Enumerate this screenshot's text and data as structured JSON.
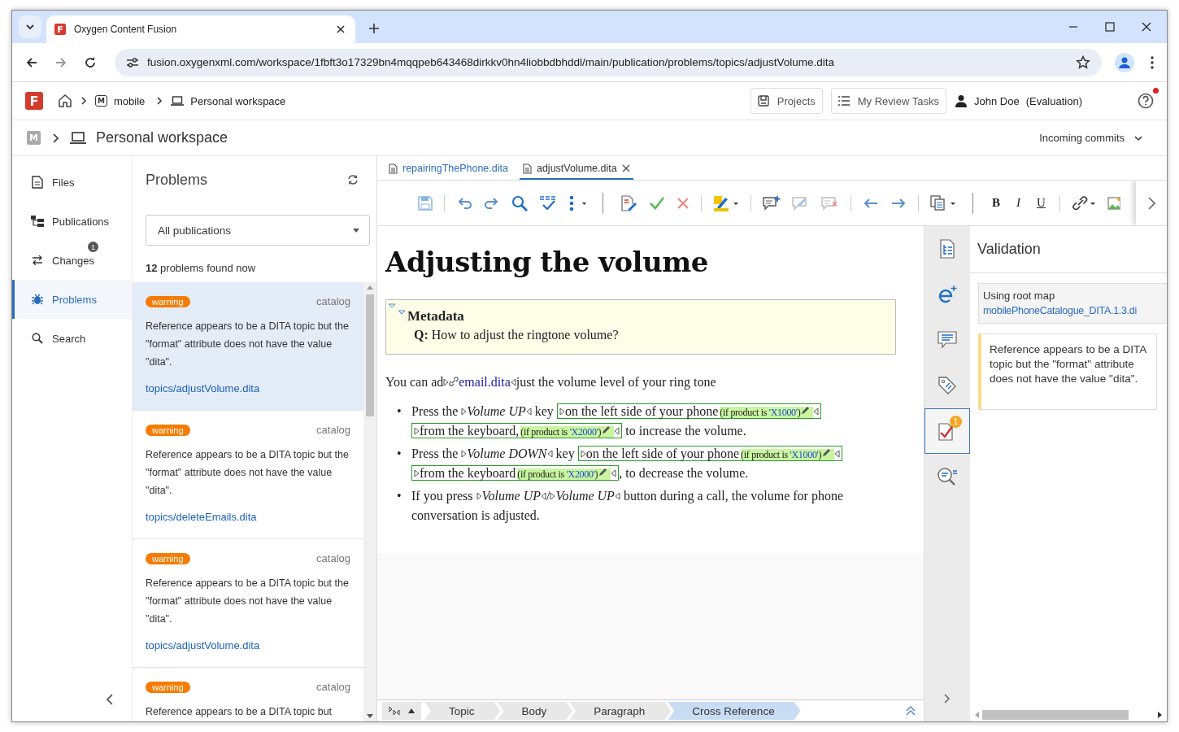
{
  "browser": {
    "favicon_letter": "F",
    "tab_title": "Oxygen Content Fusion",
    "url": "fusion.oxygenxml.com/workspace/1fbft3o17329bn4mqqpeb643468dirkkv0hn4liobbdbhddl/main/publication/problems/topics/adjustVolume.dita"
  },
  "app_header": {
    "logo_letter": "F",
    "repo_initial": "M",
    "repo": "mobile",
    "workspace": "Personal workspace",
    "buttons": [
      {
        "kind": "projects",
        "label": "Projects"
      },
      {
        "kind": "tasks",
        "label": "My Review Tasks"
      }
    ],
    "user": "John Doe",
    "user_note": "(Evaluation)",
    "help_notification": true
  },
  "workspace_bar": {
    "repo_initial": "M",
    "title": "Personal workspace",
    "incoming": "Incoming commits"
  },
  "nav": {
    "items": [
      {
        "kind": "files",
        "label": "Files",
        "selected": false
      },
      {
        "kind": "publications",
        "label": "Publications",
        "selected": false
      },
      {
        "kind": "changes",
        "label": "Changes",
        "selected": false,
        "badge": "1"
      },
      {
        "kind": "problems",
        "label": "Problems",
        "selected": true
      },
      {
        "kind": "search",
        "label": "Search",
        "selected": false
      }
    ]
  },
  "problems": {
    "title": "Problems",
    "filter": "All publications",
    "count": "12",
    "count_text": "problems found now",
    "items": [
      {
        "severity": "warning",
        "source": "catalog",
        "message": "Reference appears to be a DITA topic but the \"format\" attribute does not have the value \"dita\".",
        "link": "topics/adjustVolume.dita",
        "selected": true
      },
      {
        "severity": "warning",
        "source": "catalog",
        "message": "Reference appears to be a DITA topic but the \"format\" attribute does not have the value \"dita\".",
        "link": "topics/deleteEmails.dita",
        "selected": false
      },
      {
        "severity": "warning",
        "source": "catalog",
        "message": "Reference appears to be a DITA topic but the \"format\" attribute does not have the value \"dita\".",
        "link": "topics/adjustVolume.dita",
        "selected": false
      },
      {
        "severity": "warning",
        "source": "catalog",
        "message": "Reference appears to be a DITA topic but",
        "selected": false
      }
    ]
  },
  "editor": {
    "tabs": [
      {
        "label": "repairingThePhone.dita",
        "selected": false,
        "closable": false
      },
      {
        "label": "adjustVolume.dita",
        "selected": true,
        "closable": true
      }
    ],
    "format_buttons": [
      {
        "kind": "bold",
        "label": "B"
      },
      {
        "kind": "italic",
        "label": "I"
      },
      {
        "kind": "underline",
        "label": "U"
      }
    ],
    "heading": "Adjusting the volume",
    "metadata": {
      "title": "Metadata",
      "q_label": "Q:",
      "question": "How to adjust the ringtone volume?"
    },
    "paragraph": [
      {
        "kind": "text",
        "text": "You can ad"
      },
      {
        "kind": "xref",
        "text": "email.dita"
      },
      {
        "kind": "text",
        "text": "just the volume level of your ring tone"
      }
    ],
    "list": [
      {
        "bullet": "•",
        "parts": [
          {
            "kind": "text",
            "text": "Press the "
          },
          {
            "kind": "ui",
            "text": "Volume UP"
          },
          {
            "kind": "text",
            "text": " key "
          },
          {
            "kind": "cond",
            "text": "on the left side of your phone",
            "prefix": "(if product is ",
            "value": "'X1000'",
            "suffix": ")"
          },
          {
            "kind": "cond",
            "text": "from the keyboard,",
            "prefix": "(if product is ",
            "value": "'X2000'",
            "suffix": ")"
          },
          {
            "kind": "text",
            "text": " to increase the volume."
          }
        ]
      },
      {
        "bullet": "•",
        "parts": [
          {
            "kind": "text",
            "text": "Press the "
          },
          {
            "kind": "ui",
            "text": "Volume DOWN"
          },
          {
            "kind": "text",
            "text": " key "
          },
          {
            "kind": "cond",
            "text": "on the left side of your phone",
            "prefix": "(if product is ",
            "value": "'X1000'",
            "suffix": ")"
          },
          {
            "kind": "cond",
            "text": "from the keyboard",
            "prefix": "(if product is ",
            "value": "'X2000'",
            "suffix": ")"
          },
          {
            "kind": "text",
            "text": ", to decrease the volume."
          }
        ]
      },
      {
        "bullet": "•",
        "parts": [
          {
            "kind": "text",
            "text": "If you press "
          },
          {
            "kind": "ui",
            "text": "Volume UP"
          },
          {
            "kind": "text",
            "text": "/"
          },
          {
            "kind": "ui",
            "text": "Volume UP"
          },
          {
            "kind": "text",
            "text": " button during a call, the volume for phone"
          },
          {
            "kind": "line",
            "text": "conversation is adjusted."
          }
        ]
      }
    ],
    "breadcrumbs": [
      {
        "label": "Topic",
        "selected": false
      },
      {
        "label": "Body",
        "selected": false
      },
      {
        "label": "Paragraph",
        "selected": false
      },
      {
        "label": "Cross Reference",
        "selected": true
      }
    ]
  },
  "side_tools": [
    {
      "kind": "outline",
      "selected": false
    },
    {
      "kind": "elements",
      "selected": false
    },
    {
      "kind": "comments",
      "selected": false
    },
    {
      "kind": "tags",
      "selected": false
    },
    {
      "kind": "validation",
      "selected": true,
      "badge": "1"
    },
    {
      "kind": "find",
      "selected": false
    }
  ],
  "validation": {
    "title": "Validation",
    "root_label": "Using root map",
    "root_link": "mobilePhoneCatalogue_DITA.1.3.di",
    "message": "Reference appears to be a DITA topic but the \"format\" attribute does not have the value \"dita\"."
  }
}
